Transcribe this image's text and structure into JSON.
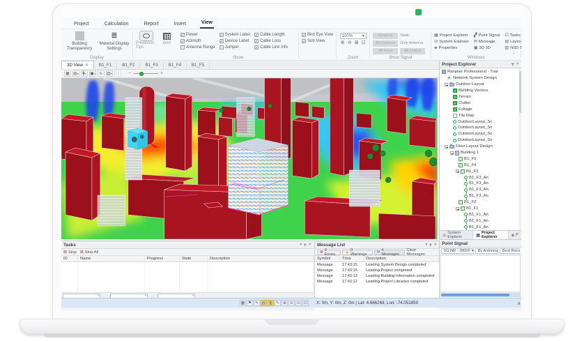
{
  "app": {
    "logo_color": "#2fb457"
  },
  "ribbon": {
    "tabs": [
      {
        "label": "Project"
      },
      {
        "label": "Calculation"
      },
      {
        "label": "Report"
      },
      {
        "label": "Insert"
      },
      {
        "label": "View"
      }
    ],
    "groups": {
      "display": {
        "label": "Display",
        "building_transparency": "Building Transparency",
        "material_display": "Material Display Settings"
      },
      "prediction": {
        "tips": "Prediction Tips",
        "grid": "Grid"
      },
      "show": {
        "label": "Show",
        "checks": [
          {
            "label": "Power",
            "check": "✓"
          },
          {
            "label": "Azimuth",
            "check": "✓"
          },
          {
            "label": "Antenna Range",
            "check": ""
          },
          {
            "label": "System Label",
            "check": "✓"
          },
          {
            "label": "Device Label",
            "check": "✓"
          },
          {
            "label": "Jumper",
            "check": ""
          },
          {
            "label": "Cable Length",
            "check": "✓"
          },
          {
            "label": "Cable Loss",
            "check": "✓"
          },
          {
            "label": "Cable Link Info",
            "check": "✓"
          },
          {
            "label": "Bird Eye View",
            "check": "✓"
          },
          {
            "label": "Sub View",
            "check": "✓"
          }
        ]
      },
      "zoom": {
        "label": "Zoom",
        "level": "100%"
      },
      "show_signal": {
        "label": "Show Signal",
        "dynamic": "Dynamic",
        "static": "Static",
        "all_devices": "All Devices",
        "only_antenna": "Only Antenna",
        "all_input": "All Input",
        "all_output": "All Output"
      },
      "windows": {
        "label": "Windows",
        "items": [
          {
            "label": "Project Explorer"
          },
          {
            "label": "System Explorer"
          },
          {
            "label": "Properties"
          },
          {
            "label": "Point Signal"
          },
          {
            "label": "Message"
          },
          {
            "label": "3D 3D"
          },
          {
            "label": "Tasks"
          },
          {
            "label": "Layers"
          },
          {
            "label": "NSD Table"
          }
        ]
      }
    }
  },
  "doc_tabs": [
    {
      "label": "3D View"
    },
    {
      "label": "B1_F1"
    },
    {
      "label": "B1_F2"
    },
    {
      "label": "B1_F3"
    },
    {
      "label": "B1_F4"
    },
    {
      "label": "B1_F5"
    }
  ],
  "project_explorer": {
    "title": "Project Explorer",
    "tree": [
      {
        "label": "Ranplan Professional - Trial"
      },
      {
        "label": "Network System Design"
      },
      {
        "label": "Outdoor Layout"
      },
      {
        "label": "Building Vectors",
        "check": "✓"
      },
      {
        "label": "Terrain",
        "check": "✓"
      },
      {
        "label": "Clutter",
        "check": "✓"
      },
      {
        "label": "Foliage",
        "check": "✓"
      },
      {
        "label": "Tile Map",
        "check": ""
      },
      {
        "label": "OutdoorLayout_Sn"
      },
      {
        "label": "OutdoorLayout_Sn"
      },
      {
        "label": "OutdoorLayout_Sn"
      },
      {
        "label": "OutdoorLayout_Sn"
      },
      {
        "label": "Floor Layout Design"
      },
      {
        "label": "Building 1"
      },
      {
        "label": "B1_F5"
      },
      {
        "label": "B1_F4"
      },
      {
        "label": "B1_F3"
      },
      {
        "label": "B1_F3_An"
      },
      {
        "label": "B1_F3_An"
      },
      {
        "label": "B1_F3_An"
      },
      {
        "label": "B1_F3_An"
      },
      {
        "label": "B1_F2"
      },
      {
        "label": "B1_F1"
      },
      {
        "label": "B1_F1_An"
      },
      {
        "label": "B1_F1_An"
      },
      {
        "label": "B1_F1_An"
      }
    ],
    "bottom_tabs": [
      {
        "label": "System Explorer"
      },
      {
        "label": "Project Explorer"
      },
      {
        "label": "P"
      }
    ]
  },
  "point_signal": {
    "title": "Point Signal",
    "band": "5G NR - 28000",
    "by": "By Antenna",
    "receive": "Best Receive"
  },
  "tasks": {
    "title": "Tasks",
    "stop": "Stop",
    "stop_all": "Stop All",
    "columns": [
      "ID",
      "Name",
      "Progress",
      "State",
      "Description"
    ]
  },
  "messages": {
    "title": "Message List",
    "errors": "0 Errors",
    "warnings": "0 Warnings",
    "count": "4 Messages",
    "clear": "Clear Messages",
    "columns": [
      "Symbol",
      "Time",
      "Description"
    ],
    "rows": [
      {
        "symbol": "Message",
        "time": "17:43:15",
        "desc": "Loading System Design completed"
      },
      {
        "symbol": "Message",
        "time": "17:43:15",
        "desc": "Loading Project completed"
      },
      {
        "symbol": "Message",
        "time": "17:43:13",
        "desc": "Loading Building Information completed"
      },
      {
        "symbol": "Message",
        "time": "17:43:12",
        "desc": "Loading Project Libraries completed"
      }
    ]
  },
  "status_bar": {
    "coords": "X: 0m, Y: 0m, Z: 0m | Lat: 4.666269, Lon: -74.051859"
  },
  "icons": {
    "status": [
      "grid",
      "flag",
      "snap",
      "layers",
      "layers2",
      "draw",
      "zoom-in",
      "zoom-out",
      "zoom-center",
      "zoom-window"
    ]
  },
  "viewport": {
    "heatmap_colors": {
      "low": "#2a55f0",
      "cyan": "#37c6f2",
      "mid": "#3fd24b",
      "warm": "#f2ee2e",
      "high": "#ff3c00"
    },
    "building_color": "#9c101c"
  }
}
